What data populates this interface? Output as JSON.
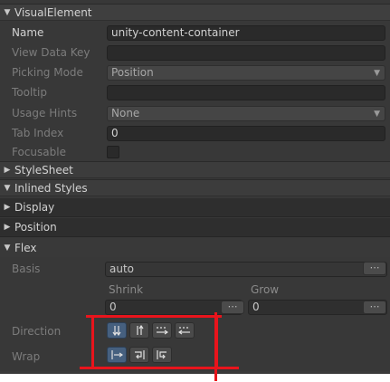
{
  "visual_element": {
    "title": "VisualElement",
    "fields": {
      "name": {
        "label": "Name",
        "value": "unity-content-container"
      },
      "view_data_key": {
        "label": "View Data Key",
        "value": ""
      },
      "picking_mode": {
        "label": "Picking Mode",
        "value": "Position"
      },
      "tooltip": {
        "label": "Tooltip",
        "value": ""
      },
      "usage_hints": {
        "label": "Usage Hints",
        "value": "None"
      },
      "tab_index": {
        "label": "Tab Index",
        "value": "0"
      },
      "focusable": {
        "label": "Focusable",
        "checked": false
      }
    }
  },
  "stylesheet": {
    "title": "StyleSheet"
  },
  "inlined_styles": {
    "title": "Inlined Styles"
  },
  "sections": {
    "display": "Display",
    "position": "Position",
    "flex": "Flex"
  },
  "flex": {
    "basis": {
      "label": "Basis",
      "value": "auto"
    },
    "shrink": {
      "label": "Shrink",
      "value": "0"
    },
    "grow": {
      "label": "Grow",
      "value": "0"
    },
    "direction": {
      "label": "Direction",
      "selected_index": 0,
      "buttons": [
        "column-icon",
        "column-reverse-icon",
        "row-icon",
        "row-reverse-icon"
      ]
    },
    "wrap": {
      "label": "Wrap",
      "selected_index": 0,
      "buttons": [
        "no-wrap-icon",
        "wrap-icon",
        "wrap-reverse-icon"
      ]
    }
  },
  "glyphs": {
    "expanded": "▼",
    "collapsed": "▶",
    "dropdown_caret": "▼",
    "keyword_dots": "⋯"
  },
  "annotation_color": "#e8141c"
}
